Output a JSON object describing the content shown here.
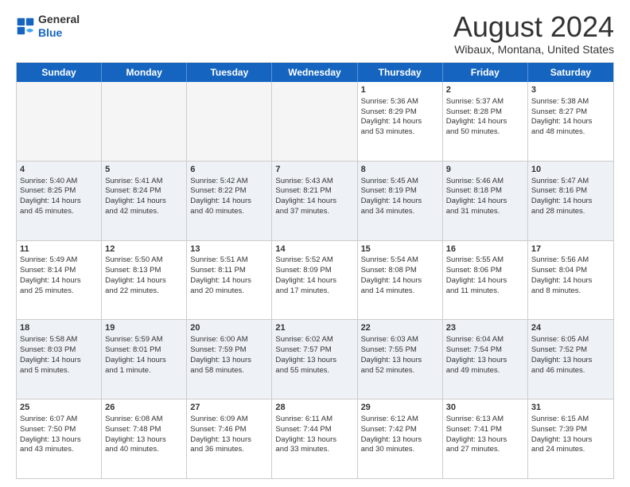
{
  "logo": {
    "general": "General",
    "blue": "Blue"
  },
  "header": {
    "title": "August 2024",
    "subtitle": "Wibaux, Montana, United States"
  },
  "weekdays": [
    "Sunday",
    "Monday",
    "Tuesday",
    "Wednesday",
    "Thursday",
    "Friday",
    "Saturday"
  ],
  "rows": [
    [
      {
        "day": "",
        "content": ""
      },
      {
        "day": "",
        "content": ""
      },
      {
        "day": "",
        "content": ""
      },
      {
        "day": "",
        "content": ""
      },
      {
        "day": "1",
        "content": "Sunrise: 5:36 AM\nSunset: 8:29 PM\nDaylight: 14 hours\nand 53 minutes."
      },
      {
        "day": "2",
        "content": "Sunrise: 5:37 AM\nSunset: 8:28 PM\nDaylight: 14 hours\nand 50 minutes."
      },
      {
        "day": "3",
        "content": "Sunrise: 5:38 AM\nSunset: 8:27 PM\nDaylight: 14 hours\nand 48 minutes."
      }
    ],
    [
      {
        "day": "4",
        "content": "Sunrise: 5:40 AM\nSunset: 8:25 PM\nDaylight: 14 hours\nand 45 minutes."
      },
      {
        "day": "5",
        "content": "Sunrise: 5:41 AM\nSunset: 8:24 PM\nDaylight: 14 hours\nand 42 minutes."
      },
      {
        "day": "6",
        "content": "Sunrise: 5:42 AM\nSunset: 8:22 PM\nDaylight: 14 hours\nand 40 minutes."
      },
      {
        "day": "7",
        "content": "Sunrise: 5:43 AM\nSunset: 8:21 PM\nDaylight: 14 hours\nand 37 minutes."
      },
      {
        "day": "8",
        "content": "Sunrise: 5:45 AM\nSunset: 8:19 PM\nDaylight: 14 hours\nand 34 minutes."
      },
      {
        "day": "9",
        "content": "Sunrise: 5:46 AM\nSunset: 8:18 PM\nDaylight: 14 hours\nand 31 minutes."
      },
      {
        "day": "10",
        "content": "Sunrise: 5:47 AM\nSunset: 8:16 PM\nDaylight: 14 hours\nand 28 minutes."
      }
    ],
    [
      {
        "day": "11",
        "content": "Sunrise: 5:49 AM\nSunset: 8:14 PM\nDaylight: 14 hours\nand 25 minutes."
      },
      {
        "day": "12",
        "content": "Sunrise: 5:50 AM\nSunset: 8:13 PM\nDaylight: 14 hours\nand 22 minutes."
      },
      {
        "day": "13",
        "content": "Sunrise: 5:51 AM\nSunset: 8:11 PM\nDaylight: 14 hours\nand 20 minutes."
      },
      {
        "day": "14",
        "content": "Sunrise: 5:52 AM\nSunset: 8:09 PM\nDaylight: 14 hours\nand 17 minutes."
      },
      {
        "day": "15",
        "content": "Sunrise: 5:54 AM\nSunset: 8:08 PM\nDaylight: 14 hours\nand 14 minutes."
      },
      {
        "day": "16",
        "content": "Sunrise: 5:55 AM\nSunset: 8:06 PM\nDaylight: 14 hours\nand 11 minutes."
      },
      {
        "day": "17",
        "content": "Sunrise: 5:56 AM\nSunset: 8:04 PM\nDaylight: 14 hours\nand 8 minutes."
      }
    ],
    [
      {
        "day": "18",
        "content": "Sunrise: 5:58 AM\nSunset: 8:03 PM\nDaylight: 14 hours\nand 5 minutes."
      },
      {
        "day": "19",
        "content": "Sunrise: 5:59 AM\nSunset: 8:01 PM\nDaylight: 14 hours\nand 1 minute."
      },
      {
        "day": "20",
        "content": "Sunrise: 6:00 AM\nSunset: 7:59 PM\nDaylight: 13 hours\nand 58 minutes."
      },
      {
        "day": "21",
        "content": "Sunrise: 6:02 AM\nSunset: 7:57 PM\nDaylight: 13 hours\nand 55 minutes."
      },
      {
        "day": "22",
        "content": "Sunrise: 6:03 AM\nSunset: 7:55 PM\nDaylight: 13 hours\nand 52 minutes."
      },
      {
        "day": "23",
        "content": "Sunrise: 6:04 AM\nSunset: 7:54 PM\nDaylight: 13 hours\nand 49 minutes."
      },
      {
        "day": "24",
        "content": "Sunrise: 6:05 AM\nSunset: 7:52 PM\nDaylight: 13 hours\nand 46 minutes."
      }
    ],
    [
      {
        "day": "25",
        "content": "Sunrise: 6:07 AM\nSunset: 7:50 PM\nDaylight: 13 hours\nand 43 minutes."
      },
      {
        "day": "26",
        "content": "Sunrise: 6:08 AM\nSunset: 7:48 PM\nDaylight: 13 hours\nand 40 minutes."
      },
      {
        "day": "27",
        "content": "Sunrise: 6:09 AM\nSunset: 7:46 PM\nDaylight: 13 hours\nand 36 minutes."
      },
      {
        "day": "28",
        "content": "Sunrise: 6:11 AM\nSunset: 7:44 PM\nDaylight: 13 hours\nand 33 minutes."
      },
      {
        "day": "29",
        "content": "Sunrise: 6:12 AM\nSunset: 7:42 PM\nDaylight: 13 hours\nand 30 minutes."
      },
      {
        "day": "30",
        "content": "Sunrise: 6:13 AM\nSunset: 7:41 PM\nDaylight: 13 hours\nand 27 minutes."
      },
      {
        "day": "31",
        "content": "Sunrise: 6:15 AM\nSunset: 7:39 PM\nDaylight: 13 hours\nand 24 minutes."
      }
    ]
  ]
}
